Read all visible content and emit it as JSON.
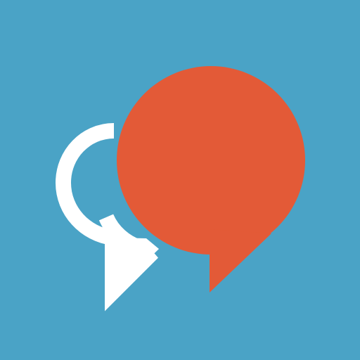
{
  "app_icon": {
    "name": "chat-bubbles-icon",
    "colors": {
      "background": "#4aa3c6",
      "primary_bubble": "#e35a37",
      "secondary_bubble_outline": "#ffffff"
    }
  }
}
